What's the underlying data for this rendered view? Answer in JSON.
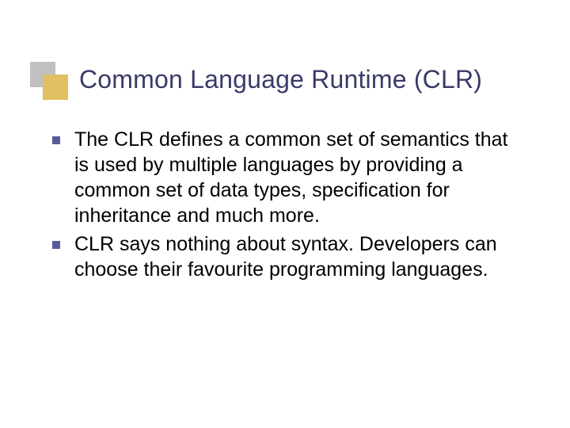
{
  "slide": {
    "title": "Common Language Runtime (CLR)",
    "bullets": [
      "The CLR defines a common set of semantics that is used by multiple languages by providing a common set of data types, specification for inheritance and much more.",
      "CLR says nothing about syntax. Developers can choose their favourite programming languages."
    ]
  }
}
